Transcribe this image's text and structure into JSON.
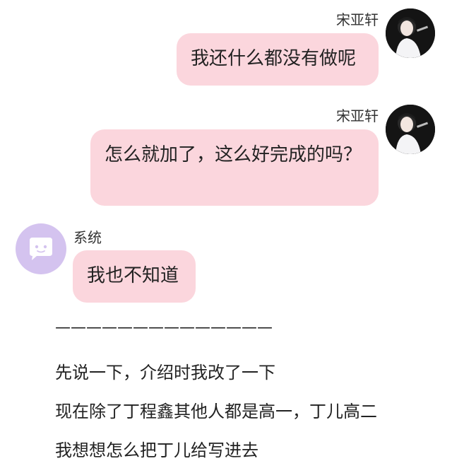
{
  "messages": [
    {
      "sender": "宋亚轩",
      "text": "我还什么都没有做呢"
    },
    {
      "sender": "宋亚轩",
      "text": "怎么就加了，这么好完成的吗？"
    },
    {
      "sender": "系统",
      "text": "我也不知道"
    }
  ],
  "divider": "——————————————",
  "paragraphs": [
    "先说一下，介绍时我改了一下",
    "现在除了丁程鑫其他人都是高一，丁儿高二",
    "我想想怎么把丁儿给写进去"
  ],
  "colors": {
    "bubble": "#fbd6dd",
    "system_avatar": "#d4c3ef"
  }
}
